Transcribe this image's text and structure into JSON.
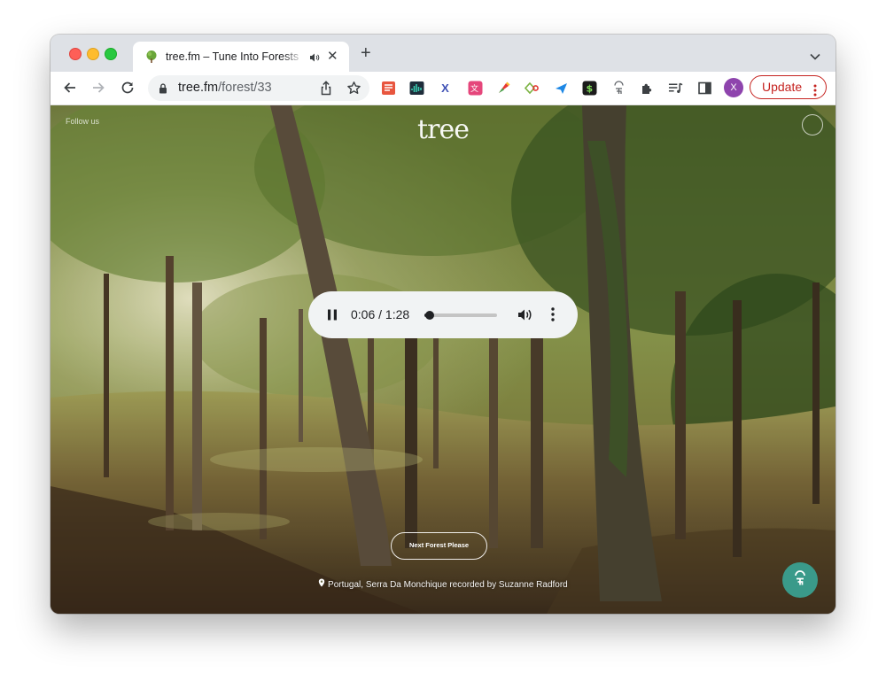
{
  "browser": {
    "tab": {
      "title": "tree.fm – Tune Into Forests",
      "favicon_icon": "tree-icon",
      "audio_icon": "speaker-icon",
      "close_icon": "close-icon"
    },
    "new_tab_symbol": "+",
    "url_host": "tree.fm",
    "url_path": "/forest/33",
    "avatar_initial": "X",
    "update_label": "Update",
    "extensions": [
      "notes-extension-icon",
      "soundwave-extension-icon",
      "x-extension-icon",
      "translate-extension-icon",
      "color-picker-extension-icon",
      "diamond-extension-icon",
      "send-extension-icon",
      "money-extension-icon",
      "tree-fm-extension-icon",
      "puzzle-extensions-icon",
      "media-control-icon",
      "side-panel-icon"
    ],
    "colors": {
      "tabstrip": "#dee1e6",
      "update_red": "#c5221f",
      "avatar": "#8e44ad"
    }
  },
  "page": {
    "brand": "tree",
    "follow_label": "Follow us",
    "player": {
      "time": "0:06 / 1:28",
      "progress_fraction": 0.068
    },
    "next_button_label": "Next Forest Please",
    "credit": "Portugal, Serra Da Monchique recorded by Suzanne Radford",
    "colors": {
      "fab": "#3a9a8a"
    }
  }
}
